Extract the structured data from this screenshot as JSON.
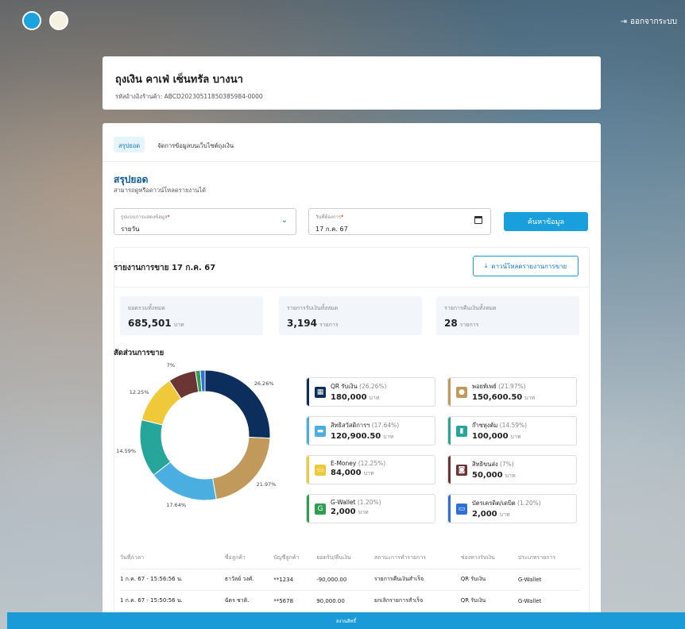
{
  "header": {
    "logout": "ออกจากระบบ",
    "logout_icon": "logout-icon"
  },
  "shop": {
    "name": "ถุงเงิน คาเฟ่ เซ็นทรัล บางนา",
    "ref": "รหัสอ้างอิงร้านค้า: ABCD20230511850385984-0000"
  },
  "tabs": [
    {
      "label": "สรุปยอด",
      "active": true
    },
    {
      "label": "จัดการข้อมูลบนเว็บไซต์ถุงเงิน",
      "active": false
    }
  ],
  "summary": {
    "title": "สรุปยอด",
    "subtitle": "สามารถดูหรือดาวน์โหลดรายงานได้"
  },
  "filters": {
    "mode_label": "รูปแบบการแสดงข้อมูล",
    "mode_value": "รายวัน",
    "date_label": "วันที่ต้องการ",
    "date_value": "17 ก.ค. 67",
    "search_button": "ค้นหาข้อมูล"
  },
  "report": {
    "title": "รายงานการขาย 17 ก.ค. 67",
    "download_button": "ดาวน์โหลดรายงานการขาย"
  },
  "stats": [
    {
      "label": "ยอดรวมทั้งหมด",
      "value": "685,501",
      "unit": "บาท"
    },
    {
      "label": "รายการรับเงินทั้งหมด",
      "value": "3,194",
      "unit": "รายการ"
    },
    {
      "label": "รายการคืนเงินทั้งหมด",
      "value": "28",
      "unit": "รายการ"
    }
  ],
  "ratio_title": "สัดส่วนการขาย",
  "chart_data": {
    "type": "pie",
    "values": [
      26.26,
      21.97,
      17.64,
      14.59,
      12.25,
      7,
      1.2,
      1.2
    ],
    "labels": [
      "26.26%",
      "21.97%",
      "17.64%",
      "14.59%",
      "12.25%",
      "7%",
      "",
      ""
    ],
    "colors": [
      "#0b2e5c",
      "#c19a5b",
      "#4aaee0",
      "#26a69a",
      "#f0c93a",
      "#6b3535",
      "#2e9e4f",
      "#2f6fd6"
    ]
  },
  "payments": [
    {
      "name": "QR รับเงิน",
      "pct": "(26.26%)",
      "amount": "180,000",
      "unit": "บาท",
      "color": "#0b2e5c",
      "icon": "qr-icon"
    },
    {
      "name": "พอยท์เพย์",
      "pct": "(21.97%)",
      "amount": "150,600.50",
      "unit": "บาท",
      "color": "#c19a5b",
      "icon": "pointpay-icon"
    },
    {
      "name": "สิทธิสวัสดิการฯ",
      "pct": "(17.64%)",
      "amount": "120,900.50",
      "unit": "บาท",
      "color": "#4aaee0",
      "icon": "welfare-card-icon"
    },
    {
      "name": "ก๊าซหุงต้ม",
      "pct": "(14.59%)",
      "amount": "100,000",
      "unit": "บาท",
      "color": "#26a69a",
      "icon": "gas-icon"
    },
    {
      "name": "E-Money",
      "pct": "(12.25%)",
      "amount": "84,000",
      "unit": "บาท",
      "color": "#f0c93a",
      "icon": "emoney-icon"
    },
    {
      "name": "สิทธิขนส่ง",
      "pct": "(7%)",
      "amount": "50,000",
      "unit": "บาท",
      "color": "#6b3535",
      "icon": "bus-icon"
    },
    {
      "name": "G-Wallet",
      "pct": "(1.20%)",
      "amount": "2,000",
      "unit": "บาท",
      "color": "#2e9e4f",
      "icon": "gwallet-icon"
    },
    {
      "name": "บัตรเครดิต/เดบิต",
      "pct": "(1.20%)",
      "amount": "2,000",
      "unit": "บาท",
      "color": "#2f6fd6",
      "icon": "credit-card-icon"
    }
  ],
  "table": {
    "headers": [
      "วันที่/เวลา",
      "ชื่อลูกค้า",
      "บัญชีลูกค้า",
      "ยอดรับ/คืนเงิน",
      "สถานะการทำรายการ",
      "ช่องทางรับเงิน",
      "ประเภทรายการ"
    ],
    "rows": [
      [
        "1 ก.ค. 67 - 15:56:56 น.",
        "ธาวัลย์ วงศ์.",
        "**1234",
        "-90,000.00",
        "รายการคืนเงินสำเร็จ",
        "QR รับเงิน",
        "G-Wallet"
      ],
      [
        "1 ก.ค. 67 - 15:50:56 น.",
        "ฉัตร ชาติ.",
        "**5678",
        "90,000.00",
        "ยกเลิกรายการสำเร็จ",
        "QR รับเงิน",
        "G-Wallet"
      ]
    ]
  },
  "footer": "สงวนสิทธิ์"
}
